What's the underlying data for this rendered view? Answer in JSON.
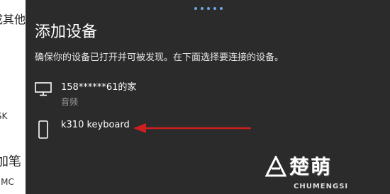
{
  "background": {
    "line1": "成其他",
    "line2": "DESK",
    "line3": "加笔",
    "line4": "CAL MC"
  },
  "dialog": {
    "title": "添加设备",
    "subtitle": "确保你的设备已打开并可被发现。在下面选择要连接的设备。",
    "devices": [
      {
        "name": "158******61的家",
        "type": "音频",
        "icon": "monitor-icon"
      },
      {
        "name": "k310 keyboard",
        "type": "",
        "icon": "phone-device-icon"
      }
    ]
  },
  "annotation": {
    "arrow_color": "#cc1f1f",
    "points_to": "k310 keyboard"
  },
  "watermark": {
    "brand": "楚萌",
    "brand_latin": "CHUMENGSI"
  },
  "colors": {
    "dialog_bg": "#2b2b2b",
    "accent": "#6fa8dc",
    "text_primary": "#ffffff",
    "text_secondary": "#9e9e9e"
  }
}
